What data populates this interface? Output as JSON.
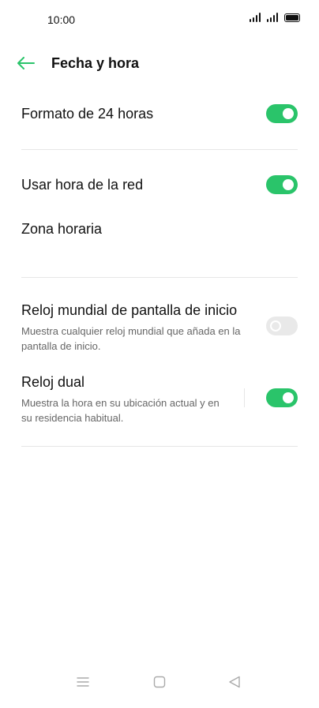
{
  "status_bar": {
    "time": "10:00"
  },
  "header": {
    "title": "Fecha y hora",
    "back_icon": "arrow-left-icon"
  },
  "settings": {
    "format_24h": {
      "label": "Formato de 24 horas",
      "on": true
    },
    "network_time": {
      "label": "Usar hora de la red",
      "on": true
    },
    "timezone": {
      "label": "Zona horaria"
    },
    "world_clock": {
      "label": "Reloj mundial de pantalla de inicio",
      "description": "Muestra cualquier reloj mundial que añada en la pantalla de inicio.",
      "on": false
    },
    "dual_clock": {
      "label": "Reloj dual",
      "description": "Muestra la hora en su ubicación actual y en su residencia habitual.",
      "on": true
    }
  },
  "colors": {
    "accent": "#2ac46a",
    "toggle_off": "#e9e9e9"
  },
  "nav_bar": {
    "icons": [
      "menu-icon",
      "home-square-icon",
      "back-triangle-icon"
    ]
  }
}
